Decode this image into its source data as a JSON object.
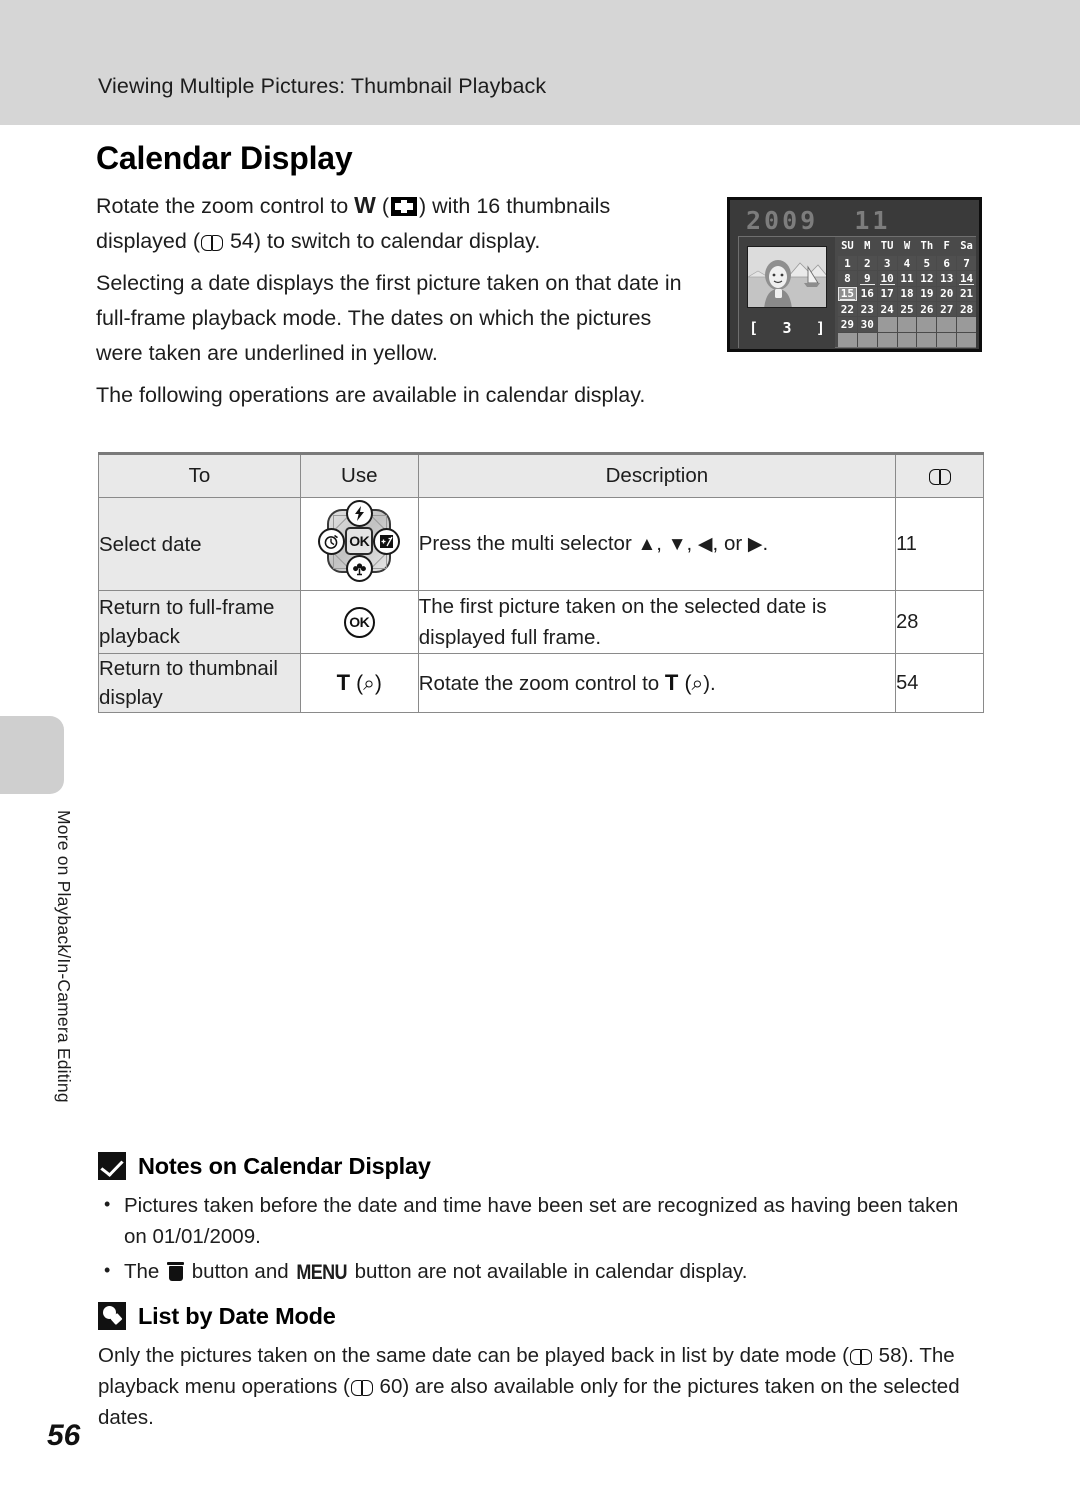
{
  "header": {
    "running_title": "Viewing Multiple Pictures: Thumbnail Playback"
  },
  "page": {
    "number": "56",
    "side_tab_label": "More on Playback/In-Camera Editing"
  },
  "section": {
    "title": "Calendar Display",
    "paragraphs": {
      "p1_a": "Rotate the zoom control to ",
      "p1_w": "W",
      "p1_b": ") with 16 thumbnails displayed (",
      "p1_ref": "54",
      "p1_c": ") to switch to calendar display.",
      "p2": "Selecting a date displays the first picture taken on that date in full-frame playback mode. The dates on which the pictures were taken are underlined in yellow.",
      "p3": "The following operations are available in calendar display."
    }
  },
  "lcd": {
    "year": "2009",
    "month": "11",
    "frame_count_open": "[",
    "frame_count": "3",
    "frame_count_close": "]",
    "dow": [
      "SU",
      "M",
      "TU",
      "W",
      "Th",
      "F",
      "Sa"
    ],
    "days": [
      {
        "n": "1"
      },
      {
        "n": "2"
      },
      {
        "n": "3"
      },
      {
        "n": "4"
      },
      {
        "n": "5"
      },
      {
        "n": "6"
      },
      {
        "n": "7"
      },
      {
        "n": "8"
      },
      {
        "n": "9",
        "marked": true
      },
      {
        "n": "10",
        "marked": true
      },
      {
        "n": "11"
      },
      {
        "n": "12"
      },
      {
        "n": "13"
      },
      {
        "n": "14",
        "marked": true
      },
      {
        "n": "15",
        "marked": true,
        "selected": true
      },
      {
        "n": "16"
      },
      {
        "n": "17"
      },
      {
        "n": "18"
      },
      {
        "n": "19"
      },
      {
        "n": "20"
      },
      {
        "n": "21"
      },
      {
        "n": "22"
      },
      {
        "n": "23"
      },
      {
        "n": "24"
      },
      {
        "n": "25"
      },
      {
        "n": "26"
      },
      {
        "n": "27"
      },
      {
        "n": "28"
      },
      {
        "n": "29"
      },
      {
        "n": "30"
      },
      {
        "n": "",
        "empty": true
      },
      {
        "n": "",
        "empty": true
      },
      {
        "n": "",
        "empty": true
      },
      {
        "n": "",
        "empty": true
      },
      {
        "n": "",
        "empty": true
      },
      {
        "n": "",
        "empty": true
      },
      {
        "n": "",
        "empty": true
      },
      {
        "n": "",
        "empty": true
      },
      {
        "n": "",
        "empty": true
      },
      {
        "n": "",
        "empty": true
      },
      {
        "n": "",
        "empty": true
      },
      {
        "n": "",
        "empty": true
      }
    ],
    "colors": {
      "screen_bg": "#3a3a3a",
      "cell_bg": "#4f4f4f",
      "empty_cell_bg": "#9a9a9a",
      "selected_bg": "#8d8d8d",
      "text": "#ffffff",
      "year_text": "#7d7d7d"
    }
  },
  "table": {
    "headers": {
      "to": "To",
      "use": "Use",
      "description": "Description",
      "ref": "book-icon"
    },
    "rows": [
      {
        "to": "Select date",
        "use_type": "multi-selector",
        "use_labels": {
          "ok": "OK"
        },
        "desc_a": "Press the multi selector ",
        "desc_b": ", ",
        "desc_c": ", ",
        "desc_d": ", or ",
        "desc_e": ".",
        "ref": "11"
      },
      {
        "to": "Return to full-frame playback",
        "use_type": "ok-button",
        "use_label": "OK",
        "desc": "The first picture taken on the selected date is displayed full frame.",
        "ref": "28"
      },
      {
        "to": "Return to thumbnail display",
        "use_type": "t-zoom",
        "use_label": "T",
        "desc_a": "Rotate the zoom control to ",
        "desc_b": "T",
        "desc_c": ").",
        "ref": "54"
      }
    ]
  },
  "notes": {
    "title": "Notes on Calendar Display",
    "icon": "check-box-icon",
    "bullets": [
      "Pictures taken before the date and time have been set are recognized as having been taken on 01/01/2009.",
      "The  button and  button are not available in calendar display."
    ],
    "bullet2_a": "The ",
    "bullet2_b": " button and ",
    "bullet2_menu": "MENU",
    "bullet2_c": " button are not available in calendar display."
  },
  "list_by_date": {
    "icon": "light-bulb-icon",
    "title": "List by Date Mode",
    "body_a": "Only the pictures taken on the same date can be played back in list by date mode (",
    "body_ref1": "58",
    "body_b": "). The playback menu operations (",
    "body_ref2": "60",
    "body_c": ") are also available only for the pictures taken on the selected dates."
  }
}
